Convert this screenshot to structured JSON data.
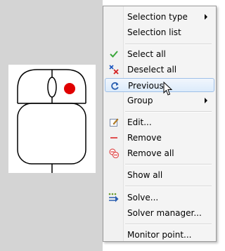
{
  "menu": {
    "items": [
      {
        "label": "Selection type",
        "icon": "",
        "submenu": true
      },
      {
        "label": "Selection list",
        "icon": "",
        "submenu": false
      },
      {
        "label": "Select all",
        "icon": "green-check-icon",
        "submenu": false
      },
      {
        "label": "Deselect all",
        "icon": "red-x-icon",
        "submenu": false
      },
      {
        "label": "Previous",
        "icon": "refresh-icon",
        "submenu": false,
        "highlighted": true
      },
      {
        "label": "Group",
        "icon": "",
        "submenu": true
      },
      {
        "label": "Edit...",
        "icon": "edit-icon",
        "submenu": false
      },
      {
        "label": "Remove",
        "icon": "minus-icon",
        "submenu": false
      },
      {
        "label": "Remove all",
        "icon": "remove-all-icon",
        "submenu": false
      },
      {
        "label": "Show all",
        "icon": "",
        "submenu": false
      },
      {
        "label": "Solve...",
        "icon": "solve-icon",
        "submenu": false
      },
      {
        "label": "Solver manager...",
        "icon": "",
        "submenu": false
      },
      {
        "label": "Monitor point...",
        "icon": "",
        "submenu": false
      }
    ]
  },
  "colors": {
    "accent_red": "#e00000",
    "hover_border": "#9fc0e8"
  }
}
